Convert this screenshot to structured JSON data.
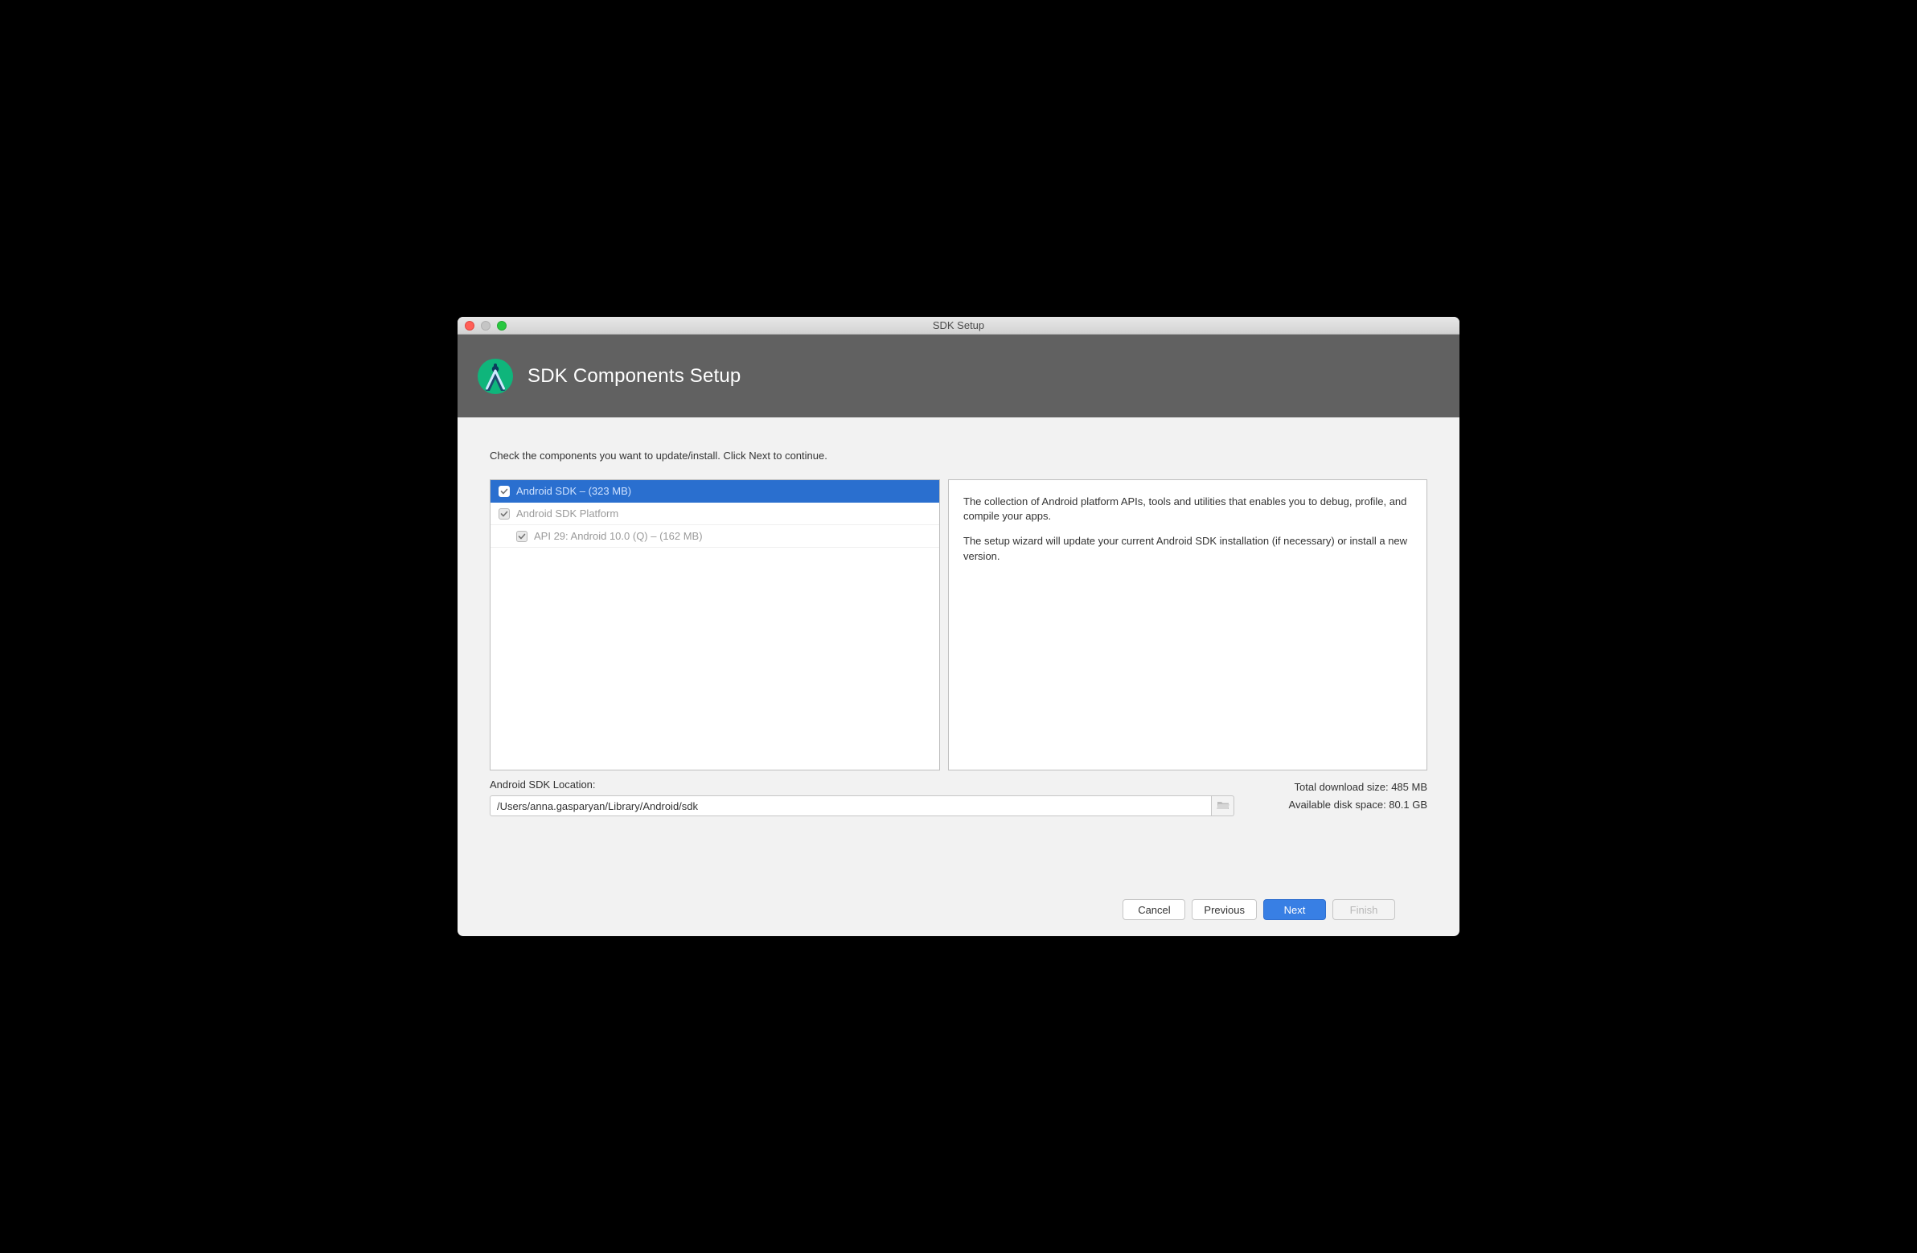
{
  "window": {
    "title": "SDK Setup"
  },
  "header": {
    "title": "SDK Components Setup"
  },
  "instruction": "Check the components you want to update/install. Click Next to continue.",
  "tree": [
    {
      "indent": 10,
      "label": "Android SDK – (323 MB)",
      "checked": true,
      "disabled": false,
      "selected": true
    },
    {
      "indent": 10,
      "label": "Android SDK Platform",
      "checked": true,
      "disabled": true,
      "selected": false
    },
    {
      "indent": 32,
      "label": "API 29: Android 10.0 (Q) – (162 MB)",
      "checked": true,
      "disabled": true,
      "selected": false
    }
  ],
  "description": {
    "p1": "The collection of Android platform APIs, tools and utilities that enables you to debug, profile, and compile your apps.",
    "p2": "The setup wizard will update your current Android SDK installation (if necessary) or install a new version."
  },
  "location": {
    "label": "Android SDK Location:",
    "path": "/Users/anna.gasparyan/Library/Android/sdk"
  },
  "info": {
    "download_label": "Total download size: ",
    "download_value": "485 MB",
    "disk_label": "Available disk space: ",
    "disk_value": "80.1 GB"
  },
  "buttons": {
    "cancel": "Cancel",
    "previous": "Previous",
    "next": "Next",
    "finish": "Finish"
  }
}
